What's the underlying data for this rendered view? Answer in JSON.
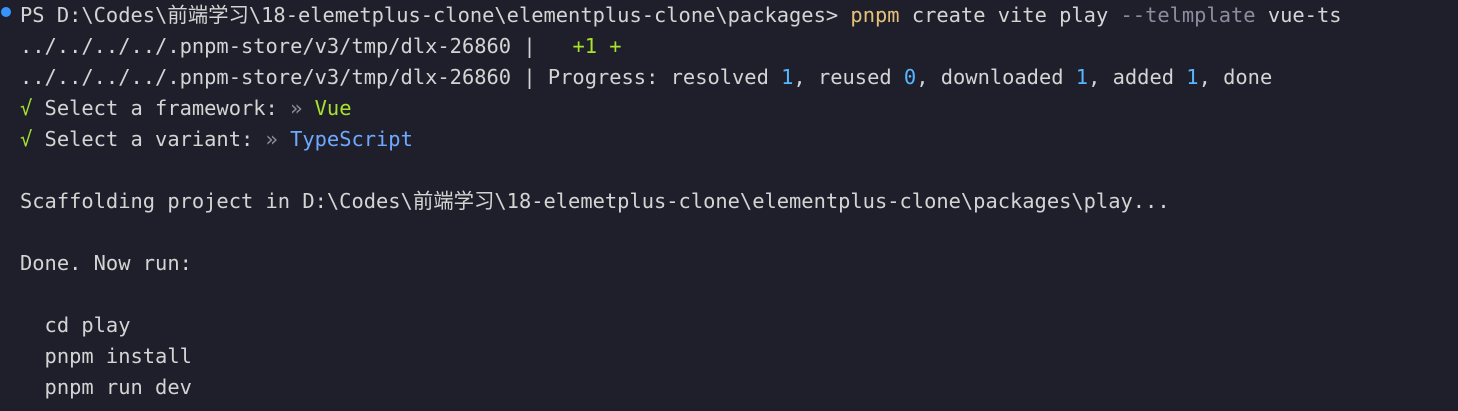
{
  "terminal": {
    "prompt": {
      "prefix": "PS D:\\Codes\\前端学习\\18-elemetplus-clone\\elementplus-clone\\packages>",
      "command": "pnpm",
      "args": "create vite play",
      "flag": "--telmplate",
      "value": "vue-ts"
    },
    "dlx_line1": {
      "path": "../../../../.pnpm-store/v3/tmp/dlx-26860 |   ",
      "added": "+1 +"
    },
    "dlx_line2": {
      "path": "../../../../.pnpm-store/v3/tmp/dlx-26860 | Progress: resolved ",
      "resolved": "1",
      "reused_label": ", reused ",
      "reused": "0",
      "downloaded_label": ", downloaded ",
      "downloaded": "1",
      "added_label": ", added ",
      "added": "1",
      "done_label": ", done"
    },
    "framework": {
      "check": "√",
      "label": " Select a framework: ",
      "arrow": "»",
      "value": " Vue"
    },
    "variant": {
      "check": "√",
      "label": " Select a variant: ",
      "arrow": "»",
      "value": " TypeScript"
    },
    "scaffolding": "Scaffolding project in D:\\Codes\\前端学习\\18-elemetplus-clone\\elementplus-clone\\packages\\play...",
    "done": "Done. Now run:",
    "commands": [
      "  cd play",
      "  pnpm install",
      "  pnpm run dev"
    ]
  },
  "colors": {
    "background": "#1f1f2b",
    "text": "#d4d4d4",
    "command": "#e5c07b",
    "flag": "#8c8c9f",
    "number": "#56b6ff",
    "check": "#a6e22e",
    "selected": "#a6e22e",
    "typescript": "#6fa8ff",
    "prompt_dot": "#3794ff"
  }
}
